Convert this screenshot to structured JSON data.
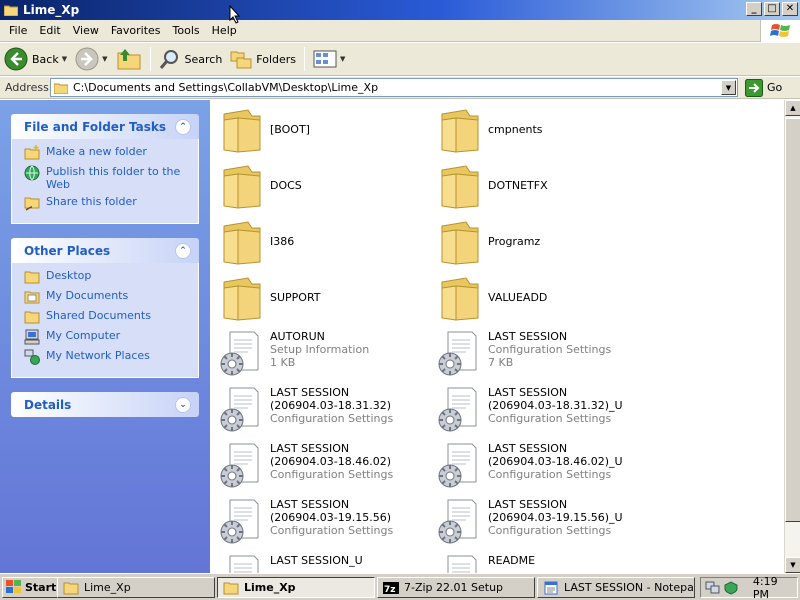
{
  "window": {
    "title": "Lime_Xp",
    "buttons": {
      "minimize": "_",
      "maximize": "□",
      "close": "✕"
    }
  },
  "menu": [
    "File",
    "Edit",
    "View",
    "Favorites",
    "Tools",
    "Help"
  ],
  "toolbar": {
    "back": "Back",
    "search": "Search",
    "folders": "Folders"
  },
  "address": {
    "label": "Address",
    "path": "C:\\Documents and Settings\\CollabVM\\Desktop\\Lime_Xp",
    "go": "Go"
  },
  "taskpane": {
    "file_tasks": {
      "title": "File and Folder Tasks",
      "items": [
        "Make a new folder",
        "Publish this folder to the Web",
        "Share this folder"
      ]
    },
    "other_places": {
      "title": "Other Places",
      "items": [
        "Desktop",
        "My Documents",
        "Shared Documents",
        "My Computer",
        "My Network Places"
      ]
    },
    "details": {
      "title": "Details"
    }
  },
  "files": [
    {
      "name": "[BOOT]",
      "type": "folder"
    },
    {
      "name": "cmpnents",
      "type": "folder"
    },
    {
      "name": "DOCS",
      "type": "folder"
    },
    {
      "name": "DOTNETFX",
      "type": "folder"
    },
    {
      "name": "I386",
      "type": "folder"
    },
    {
      "name": "Programz",
      "type": "folder"
    },
    {
      "name": "SUPPORT",
      "type": "folder"
    },
    {
      "name": "VALUEADD",
      "type": "folder"
    },
    {
      "name": "AUTORUN",
      "sub1": "Setup Information",
      "sub2": "1 KB",
      "type": "settings"
    },
    {
      "name": "LAST SESSION",
      "sub1": "Configuration Settings",
      "sub2": "7 KB",
      "type": "settings"
    },
    {
      "name": "LAST SESSION",
      "name2": "(206904.03-18.31.32)",
      "sub1": "Configuration Settings",
      "type": "settings"
    },
    {
      "name": "LAST SESSION",
      "name2": "(206904.03-18.31.32)_U",
      "sub1": "Configuration Settings",
      "type": "settings"
    },
    {
      "name": "LAST SESSION",
      "name2": "(206904.03-18.46.02)",
      "sub1": "Configuration Settings",
      "type": "settings"
    },
    {
      "name": "LAST SESSION",
      "name2": "(206904.03-18.46.02)_U",
      "sub1": "Configuration Settings",
      "type": "settings"
    },
    {
      "name": "LAST SESSION",
      "name2": "(206904.03-19.15.56)",
      "sub1": "Configuration Settings",
      "type": "settings"
    },
    {
      "name": "LAST SESSION",
      "name2": "(206904.03-19.15.56)_U",
      "sub1": "Configuration Settings",
      "type": "settings"
    },
    {
      "name": "LAST SESSION_U",
      "type": "settings"
    },
    {
      "name": "README",
      "type": "settings"
    }
  ],
  "taskbar": {
    "start": "Start",
    "tasks": [
      "Lime_Xp",
      "Lime_Xp",
      "7-Zip 22.01 Setup",
      "LAST SESSION - Notepad"
    ],
    "time": "4:19 PM"
  },
  "colors": {
    "link": "#215dc6",
    "title_start": "#0a246a",
    "pane": "#7ba2e7"
  }
}
